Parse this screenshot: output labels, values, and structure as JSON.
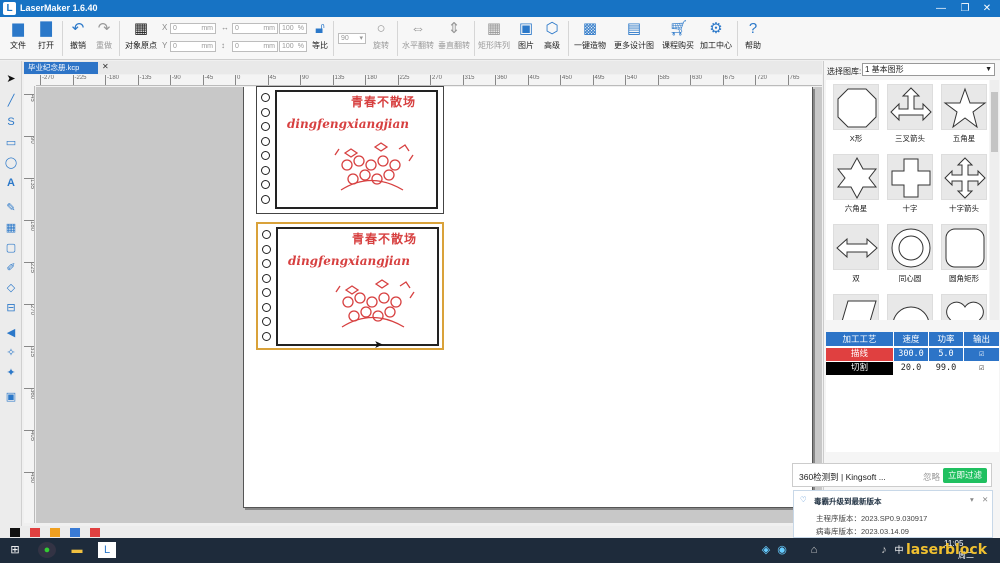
{
  "titlebar": {
    "app_title": "LaserMaker 1.6.40",
    "min": "—",
    "max": "❐",
    "close": "✕"
  },
  "toolbar": {
    "file": "文件",
    "open": "打开",
    "undo": "撤销",
    "redo": "重做",
    "object_origin": "对象原点",
    "x_label": "X",
    "y_label": "Y",
    "w_label": "↔",
    "h_label": "↕",
    "x_val": "0",
    "y_val": "0",
    "mm": "mm",
    "w_val": "0",
    "h_val": "0",
    "pct_w": "100",
    "pct_h": "100",
    "pct": "%",
    "equal_ratio": "等比",
    "rotate_val": "90",
    "rotate": "旋转",
    "hflip": "水平翻转",
    "vflip": "垂直翻转",
    "array": "矩形阵列",
    "image": "图片",
    "advanced": "高级",
    "one_click": "一键造物",
    "more_designs": "更多设计图",
    "course": "课程购买",
    "center": "加工中心",
    "help": "帮助"
  },
  "document": {
    "tab_name": "毕业纪念册.kcp",
    "tab_close": "✕"
  },
  "ruler": {
    "h_ticks": [
      "-270",
      "-225",
      "-180",
      "-135",
      "-90",
      "-45",
      "0",
      "45",
      "90",
      "135",
      "180",
      "225",
      "270",
      "315",
      "360",
      "405",
      "450",
      "495",
      "540",
      "585",
      "630",
      "675",
      "720",
      "765"
    ],
    "v_ticks": [
      "45",
      "90",
      "135",
      "180",
      "225",
      "270",
      "315",
      "360",
      "405",
      "450"
    ]
  },
  "cards": [
    {
      "title": "青春不散场",
      "pinyin": "dingfengxiangjian"
    },
    {
      "title": "青春不散场",
      "pinyin": "dingfengxiangjian"
    }
  ],
  "right_panel": {
    "library_label": "选择图库:",
    "library_value": "1 基本图形",
    "shapes": [
      "X形",
      "三叉箭头",
      "五角星",
      "六角星",
      "十字",
      "十字箭头",
      "双",
      "同心圆",
      "圆角矩形"
    ]
  },
  "process_table": {
    "headers": [
      "加工工艺",
      "速度",
      "功率",
      "输出"
    ],
    "rows": [
      {
        "name": "描线",
        "speed": "300.0",
        "power": "5.0",
        "output": "☑",
        "color": "#e04040"
      },
      {
        "name": "切割",
        "speed": "20.0",
        "power": "99.0",
        "output": "☑",
        "color": "#000000"
      }
    ]
  },
  "notif1": {
    "text": "360检测到 | Kingsoft ...",
    "ignore": "忽略",
    "action": "立即过滤"
  },
  "notif2": {
    "title": "毒霸升级到最新版本",
    "line1": "主程序版本：2023.SP0.9.030917",
    "line2": "病毒库版本：2023.03.14.09"
  },
  "taskbar": {
    "time": "11:05",
    "date": "周二",
    "ime": "中",
    "watermark": "laserblock"
  },
  "colors": [
    "#111111",
    "#e04040",
    "#f0a020",
    "#3a7bd5",
    "#e04040"
  ]
}
